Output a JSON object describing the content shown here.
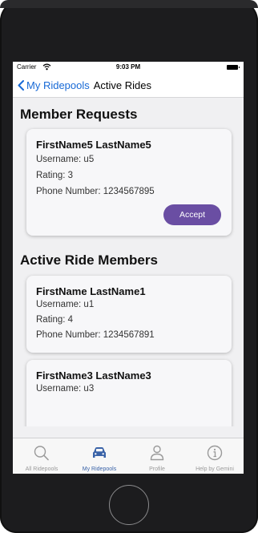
{
  "status_bar": {
    "carrier": "Carrier",
    "time": "9:03 PM"
  },
  "nav": {
    "back_label": "My Ridepools",
    "title": "Active Rides"
  },
  "member_requests": {
    "heading": "Member Requests",
    "items": [
      {
        "name": "FirstName5 LastName5",
        "username": "Username: u5",
        "rating": "Rating: 3",
        "phone": "Phone Number: 1234567895",
        "accept_label": "Accept"
      }
    ]
  },
  "active_members": {
    "heading": "Active Ride Members",
    "items": [
      {
        "name": "FirstName LastName1",
        "username": "Username: u1",
        "rating": "Rating: 4",
        "phone": "Phone Number: 1234567891"
      },
      {
        "name": "FirstName3 LastName3",
        "username": "Username: u3"
      }
    ]
  },
  "tabs": [
    {
      "label": "All Ridepools",
      "icon": "search-icon",
      "active": false
    },
    {
      "label": "My Ridepools",
      "icon": "car-icon",
      "active": true
    },
    {
      "label": "Profile",
      "icon": "person-icon",
      "active": false
    },
    {
      "label": "Help by Gemini",
      "icon": "info-icon",
      "active": false
    }
  ],
  "colors": {
    "accent": "#1769d6",
    "button": "#6a4ea3",
    "active_tab": "#3a63a8",
    "inactive_tab": "#9a9a9a"
  }
}
